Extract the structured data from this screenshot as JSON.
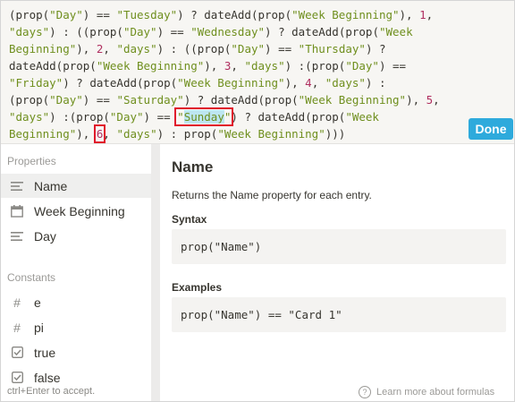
{
  "editor": {
    "lines": [
      [
        {
          "t": "(prop("
        },
        {
          "t": "\"Day\"",
          "c": "s"
        },
        {
          "t": ") == "
        },
        {
          "t": "\"Tuesday\"",
          "c": "s"
        },
        {
          "t": ") ? dateAdd(prop("
        },
        {
          "t": "\"Week Beginning\"",
          "c": "s"
        },
        {
          "t": "), "
        },
        {
          "t": "1",
          "c": "n"
        },
        {
          "t": ","
        }
      ],
      [
        {
          "t": "\"days\"",
          "c": "s"
        },
        {
          "t": ") : ((prop("
        },
        {
          "t": "\"Day\"",
          "c": "s"
        },
        {
          "t": ") == "
        },
        {
          "t": "\"Wednesday\"",
          "c": "s"
        },
        {
          "t": ") ? dateAdd(prop("
        },
        {
          "t": "\"Week",
          "c": "s"
        }
      ],
      [
        {
          "t": "Beginning\"",
          "c": "s"
        },
        {
          "t": "), "
        },
        {
          "t": "2",
          "c": "n"
        },
        {
          "t": ", "
        },
        {
          "t": "\"days\"",
          "c": "s"
        },
        {
          "t": ") : ((prop("
        },
        {
          "t": "\"Day\"",
          "c": "s"
        },
        {
          "t": ") == "
        },
        {
          "t": "\"Thursday\"",
          "c": "s"
        },
        {
          "t": ") ?"
        }
      ],
      [
        {
          "t": "dateAdd(prop("
        },
        {
          "t": "\"Week Beginning\"",
          "c": "s"
        },
        {
          "t": "), "
        },
        {
          "t": "3",
          "c": "n"
        },
        {
          "t": ", "
        },
        {
          "t": "\"days\"",
          "c": "s"
        },
        {
          "t": ") :(prop("
        },
        {
          "t": "\"Day\"",
          "c": "s"
        },
        {
          "t": ") =="
        }
      ],
      [
        {
          "t": "\"Friday\"",
          "c": "s"
        },
        {
          "t": ") ? dateAdd(prop("
        },
        {
          "t": "\"Week Beginning\"",
          "c": "s"
        },
        {
          "t": "), "
        },
        {
          "t": "4",
          "c": "n"
        },
        {
          "t": ", "
        },
        {
          "t": "\"days\"",
          "c": "s"
        },
        {
          "t": ") :"
        }
      ],
      [
        {
          "t": "(prop("
        },
        {
          "t": "\"Day\"",
          "c": "s"
        },
        {
          "t": ") == "
        },
        {
          "t": "\"Saturday\"",
          "c": "s"
        },
        {
          "t": ") ? dateAdd(prop("
        },
        {
          "t": "\"Week Beginning\"",
          "c": "s"
        },
        {
          "t": "), "
        },
        {
          "t": "5",
          "c": "n"
        },
        {
          "t": ","
        }
      ],
      [
        {
          "t": "\"days\"",
          "c": "s"
        },
        {
          "t": ") :(prop("
        },
        {
          "t": "\"Day\"",
          "c": "s"
        },
        {
          "t": ") == "
        },
        {
          "t": "\"",
          "c": "s",
          "box": "start"
        },
        {
          "t": "Sunday",
          "c": "s hl"
        },
        {
          "t": "\"",
          "c": "s",
          "box": "end"
        },
        {
          "t": ") ? dateAdd(prop("
        },
        {
          "t": "\"Week",
          "c": "s"
        }
      ],
      [
        {
          "t": "Beginning\"",
          "c": "s"
        },
        {
          "t": "), "
        },
        {
          "t": "6",
          "c": "n",
          "box": "single"
        },
        {
          "t": ", "
        },
        {
          "t": "\"days\"",
          "c": "s"
        },
        {
          "t": ") : prop("
        },
        {
          "t": "\"Week Beginning\"",
          "c": "s"
        },
        {
          "t": ")))"
        }
      ]
    ],
    "done_label": "Done"
  },
  "sidebar": {
    "properties_heading": "Properties",
    "properties": [
      {
        "label": "Name",
        "icon": "text-lines-icon",
        "selected": true
      },
      {
        "label": "Week Beginning",
        "icon": "calendar-icon",
        "selected": false
      },
      {
        "label": "Day",
        "icon": "text-lines-icon",
        "selected": false
      }
    ],
    "constants_heading": "Constants",
    "constants": [
      {
        "label": "e",
        "icon": "hash-icon"
      },
      {
        "label": "pi",
        "icon": "hash-icon"
      },
      {
        "label": "true",
        "icon": "checkbox-icon"
      },
      {
        "label": "false",
        "icon": "checkbox-icon"
      }
    ],
    "hint": "ctrl+Enter to accept."
  },
  "detail": {
    "title": "Name",
    "description": "Returns the Name property for each entry.",
    "syntax_heading": "Syntax",
    "syntax_code": "prop(\"Name\")",
    "examples_heading": "Examples",
    "example_code": "prop(\"Name\") == \"Card 1\"",
    "learn_more": "Learn more about formulas"
  }
}
